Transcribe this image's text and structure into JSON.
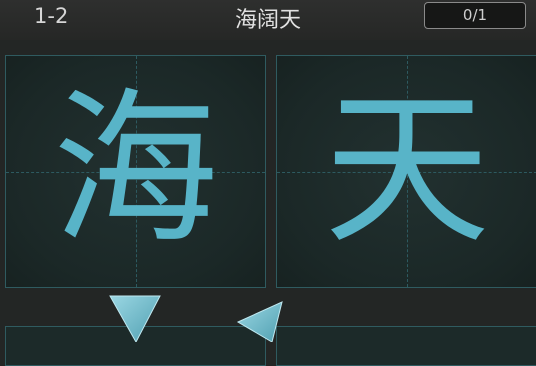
{
  "header": {
    "level_label": "1-2",
    "title": "海阔天",
    "progress": "0/1"
  },
  "boards": [
    {
      "character": "海"
    },
    {
      "character": "天"
    }
  ],
  "colors": {
    "character": "#58b4c8",
    "guide_lines": "#2d5a60",
    "arrow": "#7fc6d4"
  },
  "icons": {
    "previous": "triangle-left-icon",
    "next": "triangle-right-icon"
  }
}
